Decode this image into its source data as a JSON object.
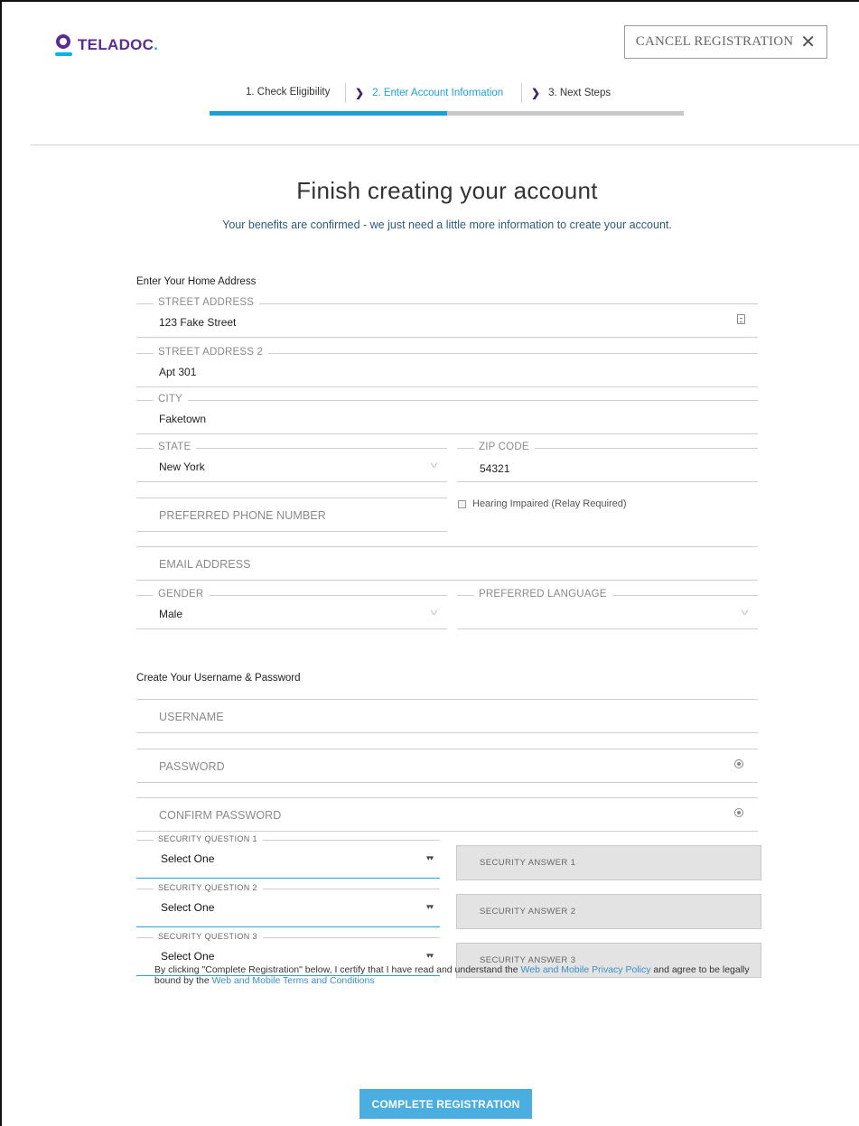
{
  "brand": {
    "name": "TELADOC",
    "dot": ".",
    "primary_color": "#5a2d91",
    "accent_color": "#00b5e2"
  },
  "header": {
    "cancel_label": "CANCEL REGISTRATION",
    "cancel_icon": "close-icon"
  },
  "steps": [
    {
      "label": "1. Check Eligibility",
      "active": false
    },
    {
      "label": "2. Enter Account Information",
      "active": true
    },
    {
      "label": "3. Next Steps",
      "active": false
    }
  ],
  "progress": {
    "completed_fraction": 0.5
  },
  "page": {
    "title": "Finish creating your account",
    "subtitle": "Your benefits are confirmed - we just need a little more information to create your account."
  },
  "address_section": {
    "label": "Enter Your Home Address",
    "street": {
      "label": "STREET ADDRESS",
      "value": "123 Fake Street"
    },
    "street2": {
      "label": "STREET ADDRESS 2",
      "value": "Apt 301"
    },
    "city": {
      "label": "CITY",
      "value": "Faketown"
    },
    "state": {
      "label": "STATE",
      "value": "New York"
    },
    "zip": {
      "label": "ZIP CODE",
      "value": "54321"
    },
    "phone": {
      "placeholder": "PREFERRED PHONE NUMBER"
    },
    "hearing": {
      "label": "Hearing Impaired (Relay Required)",
      "checked": false
    },
    "email": {
      "placeholder": "EMAIL ADDRESS"
    },
    "gender": {
      "label": "GENDER",
      "value": "Male"
    },
    "language": {
      "label": "PREFERRED LANGUAGE",
      "value": ""
    }
  },
  "account_section": {
    "label": "Create Your Username & Password",
    "username": {
      "placeholder": "USERNAME"
    },
    "password": {
      "placeholder": "PASSWORD"
    },
    "confirm": {
      "placeholder": "CONFIRM PASSWORD"
    },
    "questions": [
      {
        "label": "SECURITY QUESTION 1",
        "value": "Select One",
        "answer_placeholder": "SECURITY ANSWER 1"
      },
      {
        "label": "SECURITY QUESTION 2",
        "value": "Select One",
        "answer_placeholder": "SECURITY ANSWER 2"
      },
      {
        "label": "SECURITY QUESTION 3",
        "value": "Select One",
        "answer_placeholder": "SECURITY ANSWER 3"
      }
    ]
  },
  "legal": {
    "prefix": "By clicking \"Complete Registration\" below, I certify that I have read and understand the ",
    "privacy_link": "Web and Mobile Privacy Policy",
    "middle": " and agree to be legally bound by the ",
    "terms_link": "Web and Mobile Terms and Conditions"
  },
  "submit": {
    "label": "COMPLETE REGISTRATION"
  }
}
